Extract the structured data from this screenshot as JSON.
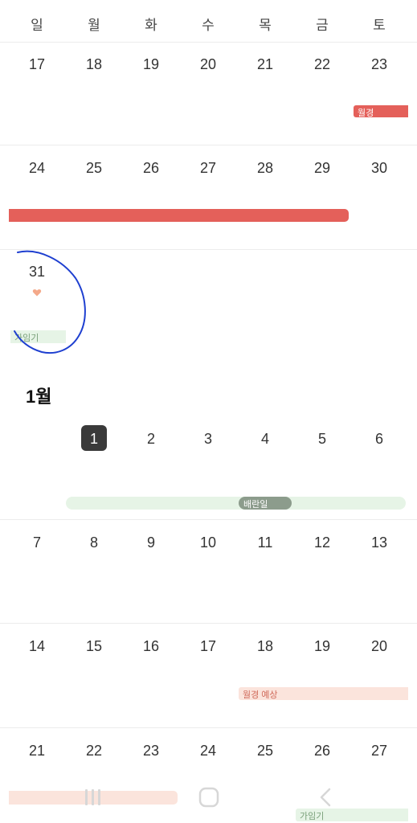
{
  "weekdays": [
    "일",
    "월",
    "화",
    "수",
    "목",
    "금",
    "토"
  ],
  "weeks": [
    {
      "days": [
        "17",
        "18",
        "19",
        "20",
        "21",
        "22",
        "23"
      ]
    },
    {
      "days": [
        "24",
        "25",
        "26",
        "27",
        "28",
        "29",
        "30"
      ]
    },
    {
      "days": [
        "31"
      ]
    }
  ],
  "month_label": "1월",
  "jan_weeks": [
    {
      "days": [
        "1",
        "2",
        "3",
        "4",
        "5",
        "6"
      ]
    },
    {
      "days": [
        "7",
        "8",
        "9",
        "10",
        "11",
        "12",
        "13"
      ]
    },
    {
      "days": [
        "14",
        "15",
        "16",
        "17",
        "18",
        "19",
        "20"
      ]
    },
    {
      "days": [
        "21",
        "22",
        "23",
        "24",
        "25",
        "26",
        "27"
      ]
    }
  ],
  "events": {
    "period_sat": "월경",
    "fertile_31": "가임기",
    "ovulation": "배란일",
    "period_expected": "월경 예상",
    "fertile_26": "가임기"
  },
  "colors": {
    "period": "#e4605a",
    "fertile": "#e6f4e6",
    "ovulation_marker": "#8c9c8c",
    "expected": "#fbe4dc",
    "today": "#3a3a3a",
    "heart": "#f4a98a",
    "annotation": "#1e3fd0"
  },
  "icons": {
    "note_marker": "heart-icon",
    "nav_recent": "recent-apps-icon",
    "nav_home": "home-icon",
    "nav_back": "back-icon"
  }
}
